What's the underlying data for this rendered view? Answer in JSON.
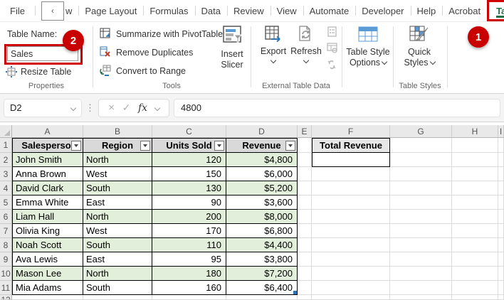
{
  "tabs": {
    "items": [
      {
        "label": "File"
      },
      {
        "label": "w",
        "overlay_chevron": "‹"
      },
      {
        "label": "Page Layout"
      },
      {
        "label": "Formulas"
      },
      {
        "label": "Data"
      },
      {
        "label": "Review"
      },
      {
        "label": "View"
      },
      {
        "label": "Automate"
      },
      {
        "label": "Developer"
      },
      {
        "label": "Help"
      },
      {
        "label": "Acrobat"
      },
      {
        "label": "Table Design"
      }
    ]
  },
  "ribbon": {
    "properties": {
      "table_name_label": "Table Name:",
      "table_name_value": "Sales",
      "resize_table_label": "Resize Table",
      "group_label": "Properties"
    },
    "tools": {
      "summarize_label": "Summarize with PivotTable",
      "remove_duplicates_label": "Remove Duplicates",
      "convert_label": "Convert to Range",
      "insert_slicer_label": "Insert Slicer",
      "group_label": "Tools"
    },
    "external": {
      "export_label": "Export",
      "refresh_label": "Refresh",
      "group_label": "External Table Data"
    },
    "styles": {
      "options_label": "Table Style Options",
      "quick_label": "Quick Styles",
      "group_label": "Table Styles"
    }
  },
  "formula_bar": {
    "name_box_value": "D2",
    "fx_label": "fx",
    "formula_value": "4800"
  },
  "annotations": {
    "step_1": "1",
    "step_2": "2"
  },
  "grid": {
    "column_headers": [
      "A",
      "B",
      "C",
      "D",
      "E",
      "F",
      "G",
      "H",
      "I"
    ],
    "row_numbers": [
      "1",
      "2",
      "3",
      "4",
      "5",
      "6",
      "7",
      "8",
      "9",
      "10",
      "11",
      "12"
    ],
    "table_headers": [
      "Salesperson",
      "Region",
      "Units Sold",
      "Revenue"
    ],
    "rows": [
      [
        "John Smith",
        "North",
        "120",
        "$4,800"
      ],
      [
        "Anna Brown",
        "West",
        "150",
        "$6,000"
      ],
      [
        "David Clark",
        "South",
        "130",
        "$5,200"
      ],
      [
        "Emma White",
        "East",
        "90",
        "$3,600"
      ],
      [
        "Liam Hall",
        "North",
        "200",
        "$8,000"
      ],
      [
        "Olivia King",
        "West",
        "170",
        "$6,800"
      ],
      [
        "Noah Scott",
        "South",
        "110",
        "$4,400"
      ],
      [
        "Ava Lewis",
        "East",
        "95",
        "$3,800"
      ],
      [
        "Mason Lee",
        "North",
        "180",
        "$7,200"
      ],
      [
        "Mia Adams",
        "South",
        "160",
        "$6,400"
      ]
    ],
    "total_revenue_label": "Total Revenue"
  },
  "colors": {
    "annotation_red": "#ce0000",
    "excel_green": "#1e7145",
    "band_green": "#e2efda",
    "table_header_gray": "#d9d9d9"
  }
}
